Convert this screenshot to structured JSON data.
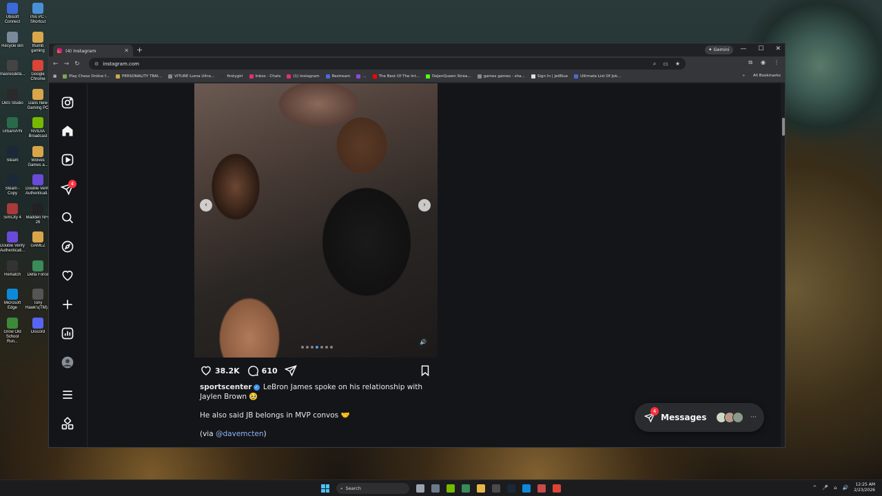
{
  "desktop": {
    "icons": [
      {
        "label": "Ubisoft Connect",
        "color": "#3a6ad8"
      },
      {
        "label": "This PC - Shortcut",
        "color": "#4a90d9"
      },
      {
        "label": "Recycle Bin",
        "color": "#7a8a9a"
      },
      {
        "label": "thumb gaming",
        "color": "#d9a54a"
      },
      {
        "label": "maxresdefa...",
        "color": "#444444"
      },
      {
        "label": "Google Chrome",
        "color": "#db4437"
      },
      {
        "label": "OBS Studio",
        "color": "#2a2a2a"
      },
      {
        "label": "Dans New Gaming PC",
        "color": "#d9a54a"
      },
      {
        "label": "UrbanVPN",
        "color": "#2a6a4a"
      },
      {
        "label": "NVIDIA Broadcast",
        "color": "#76b900"
      },
      {
        "label": "Steam",
        "color": "#1b2838"
      },
      {
        "label": "Wolves Games a...",
        "color": "#d9a54a"
      },
      {
        "label": "Steam - Copy",
        "color": "#1b2838"
      },
      {
        "label": "Double Verify Authenticati...",
        "color": "#6a4ad8"
      },
      {
        "label": "SimCity 4",
        "color": "#a83a3a"
      },
      {
        "label": "Madden NFL 26",
        "color": "#222222"
      },
      {
        "label": "Double Verify Authenticati...",
        "color": "#6a4ad8"
      },
      {
        "label": "GAMEZ",
        "color": "#d9a54a"
      },
      {
        "label": "Rematch",
        "color": "#333333"
      },
      {
        "label": "Delta Force",
        "color": "#3a8a5a"
      },
      {
        "label": "Microsoft Edge",
        "color": "#0c8ad8"
      },
      {
        "label": "Tony Hawk's(TM)...",
        "color": "#555555"
      },
      {
        "label": "Grow Old School Run...",
        "color": "#3a8a3a"
      },
      {
        "label": "Discord",
        "color": "#5865f2"
      }
    ]
  },
  "browser": {
    "tab_title": "(4) Instagram",
    "new_tab": "+",
    "gemini_label": "✦ Gemini",
    "url": "instagram.com",
    "window_controls": [
      "—",
      "☐",
      "✕"
    ],
    "bookmarks": [
      {
        "label": "Play Chess Online f...",
        "color": "#7fa650"
      },
      {
        "label": "PERSONALITY TRAI...",
        "color": "#c8a84a"
      },
      {
        "label": "VITURE Luma Ultra...",
        "color": "#888888"
      },
      {
        "label": "firstygirl",
        "color": "#333333"
      },
      {
        "label": "Inbox - Chats",
        "color": "#e1306c"
      },
      {
        "label": "(1) Instagram",
        "color": "#e1306c"
      },
      {
        "label": "Restream",
        "color": "#4a6ad8"
      },
      {
        "label": "...",
        "color": "#8a4ad8"
      },
      {
        "label": "The Best Of The Int...",
        "color": "#ff0000"
      },
      {
        "label": "DeJenQueen Strea...",
        "color": "#53fc18"
      },
      {
        "label": "games games - sha...",
        "color": "#888888"
      },
      {
        "label": "Sign In | JetBlue",
        "color": "#dddddd"
      },
      {
        "label": "Ultimate List Of Jok...",
        "color": "#4a6ad8"
      }
    ],
    "all_bookmarks_label": "All Bookmarks"
  },
  "instagram": {
    "nav_badge": "4",
    "post": {
      "likes": "38.2K",
      "comments": "610",
      "username": "sportscenter",
      "caption_line1": "LeBron James spoke on his relationship with Jaylen Brown 🥹",
      "caption_line2": "He also said JB belongs in MVP convos 🤝",
      "caption_via_prefix": "(via ",
      "caption_mention": "@davemcten",
      "caption_via_suffix": ")"
    },
    "messages": {
      "label": "Messages",
      "badge": "4",
      "more": "···"
    }
  },
  "taskbar": {
    "search_label": "Search",
    "time": "12:25 AM",
    "date": "2/23/2026"
  }
}
